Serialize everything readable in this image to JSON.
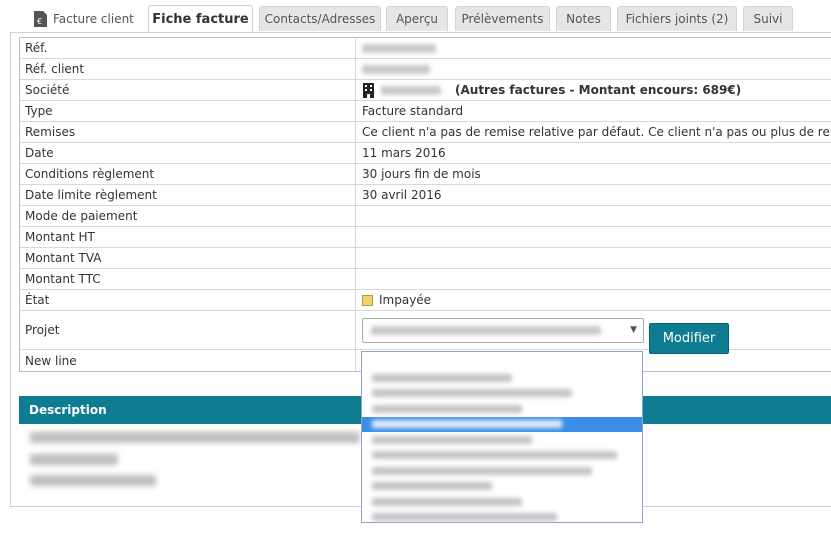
{
  "tabs": {
    "main_label": "Facture client",
    "items": [
      {
        "label": "Fiche facture"
      },
      {
        "label": "Contacts/Adresses"
      },
      {
        "label": "Aperçu"
      },
      {
        "label": "Prélèvements"
      },
      {
        "label": "Notes"
      },
      {
        "label": "Fichiers joints (2)"
      },
      {
        "label": "Suivi"
      }
    ]
  },
  "fields": {
    "ref": {
      "label": "Réf."
    },
    "ref_client": {
      "label": "Réf. client"
    },
    "societe": {
      "label": "Société",
      "note": "(Autres factures - Montant encours: 689€)"
    },
    "type": {
      "label": "Type",
      "value": "Facture standard"
    },
    "remises": {
      "label": "Remises",
      "value": "Ce client n'a pas de remise relative par défaut. Ce client n'a pas ou plus de remise fixe d"
    },
    "date": {
      "label": "Date",
      "value": "11 mars 2016"
    },
    "conditions": {
      "label": "Conditions règlement",
      "value": "30 jours fin de mois"
    },
    "date_limite": {
      "label": "Date limite règlement",
      "value": "30 avril 2016"
    },
    "mode": {
      "label": "Mode de paiement",
      "value": ""
    },
    "ht": {
      "label": "Montant HT",
      "value": ""
    },
    "tva": {
      "label": "Montant TVA",
      "value": ""
    },
    "ttc": {
      "label": "Montant TTC",
      "value": ""
    },
    "etat": {
      "label": "État",
      "value": "Impayée"
    },
    "projet": {
      "label": "Projet"
    },
    "newline": {
      "label": "New line"
    }
  },
  "actions": {
    "modifier": "Modifier"
  },
  "description": {
    "title": "Description"
  },
  "colors": {
    "accent": "#0e7c91",
    "selection": "#3b8ee8",
    "status": "#f2d36b"
  },
  "icons": {
    "tab": "invoice-document-icon",
    "company": "building-icon",
    "status": "unpaid-status-icon"
  }
}
